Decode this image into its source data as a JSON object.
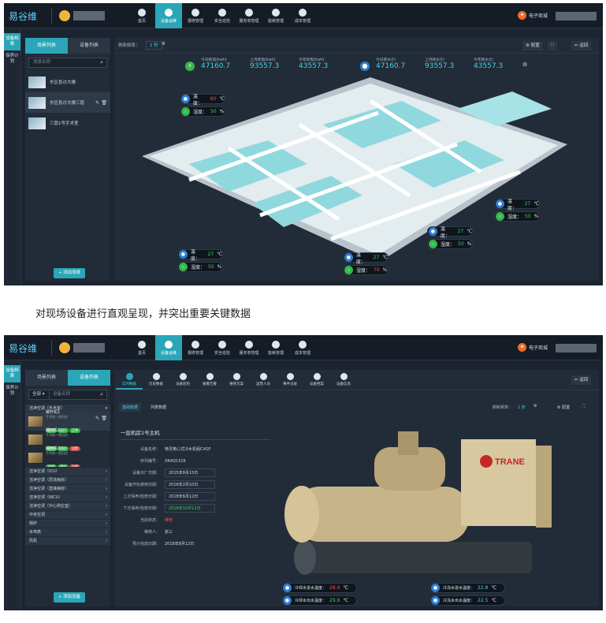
{
  "top": {
    "logo": "易谷维",
    "nav": [
      "首页",
      "设备运维",
      "报修管理",
      "安全巡检",
      "服务单管理",
      "能耗管理",
      "成本管理"
    ],
    "shop": "电子商城"
  },
  "s1": {
    "rail": [
      "设备档案",
      "保养计划"
    ],
    "tabs": [
      "场景列表",
      "设备列表"
    ],
    "search_placeholder": "场景名称",
    "scenes": [
      "东区急诊大楼",
      "东区急诊大楼三层",
      "三层1号手术室"
    ],
    "add_btn": "+ 添加场景",
    "refresh_label": "刷新频率：",
    "refresh_value": "1 秒",
    "config": "配置",
    "back": "返回",
    "energy": [
      {
        "label": "今日耗电(kwh)",
        "value": "47160.7"
      },
      {
        "label": "上月耗电(kwh)",
        "value": "93557.3"
      },
      {
        "label": "今年耗电(kwh)",
        "value": "43557.3"
      }
    ],
    "water": [
      {
        "label": "今日耗水(t)",
        "value": "47160.7"
      },
      {
        "label": "上月耗水(t)",
        "value": "93557.3"
      },
      {
        "label": "今年耗水(t)",
        "value": "43557.3"
      }
    ],
    "temp_label": "温度：",
    "hum_label": "湿度：",
    "sensors": [
      {
        "temp": "60",
        "hum": "50"
      },
      {
        "temp": "27",
        "hum": "50"
      },
      {
        "temp": "27",
        "hum": "50"
      },
      {
        "temp": "27",
        "hum": "50"
      },
      {
        "temp": "27",
        "hum": "70"
      }
    ],
    "unit_c": "℃",
    "unit_p": "%"
  },
  "caption": "对现场设备进行直观呈现，并突出重要关键数据",
  "s2": {
    "filter": "全部",
    "search_placeholder": "设备名称",
    "group": "洁净空调（手术室）",
    "devices": [
      {
        "name": "螺杆机1",
        "sub": "手术楼一楼机房",
        "tags": [
          "在线",
          "运行",
          "正常"
        ]
      },
      {
        "name": "螺杆机2",
        "sub": "手术楼一楼机房",
        "tags": [
          "在线",
          "停机",
          "告警"
        ]
      },
      {
        "name": "螺杆机3",
        "sub": "手术楼一楼机房",
        "tags": [
          "在线",
          "停机",
          "告警"
        ]
      }
    ],
    "cats": [
      "洁净空调（ICU）",
      "洁净空调（层流病房）",
      "洁净空调（直接病房）",
      "洁净空调（NICU）",
      "洁净空调（中心供应室）",
      "中央空调",
      "锅炉",
      "水电表",
      "风机"
    ],
    "add_btn": "+ 添加设备",
    "subnav": [
      "实时数据",
      "历史数据",
      "设备巡检",
      "报警告警",
      "维修方案",
      "运营人员",
      "事件记录",
      "设备档案",
      "设备信息"
    ],
    "inner_tabs": [
      "基础数据",
      "列表数据"
    ],
    "title": "一层机房1号主机",
    "fields": [
      {
        "label": "设备名称：",
        "value": "特灵离心式冷水机组CVGF"
      },
      {
        "label": "序列编号：",
        "value": "XR4Q1516"
      },
      {
        "label": "设备出厂日期：",
        "value": "2015年8月15日"
      },
      {
        "label": "设备开始使用日期：",
        "value": "2016年2月10日"
      },
      {
        "label": "上次保养/检修日期：",
        "value": "2018年6月12日"
      },
      {
        "label": "下次保养/检修日期：",
        "value": "2018年10月12日"
      },
      {
        "label": "当前状态：",
        "value": "维修"
      },
      {
        "label": "维修人：",
        "value": "张三"
      },
      {
        "label": "预计完成日期：",
        "value": "2018年8月12日"
      }
    ],
    "brand": "TRANE",
    "readings": [
      {
        "label": "冷却水进水温度：",
        "value": "28.9"
      },
      {
        "label": "冷却水出水温度：",
        "value": "29.9"
      },
      {
        "label": "冷冻水进水温度：",
        "value": "22.8"
      },
      {
        "label": "冷冻水出水温度：",
        "value": "22.5"
      }
    ],
    "unit": "℃"
  }
}
